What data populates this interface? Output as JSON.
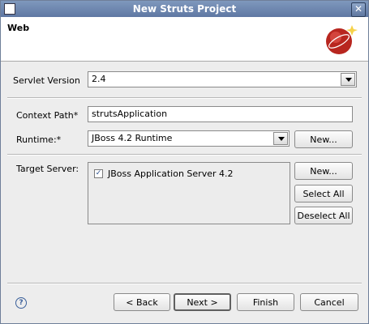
{
  "window": {
    "title": "New Struts Project",
    "close_glyph": "✕"
  },
  "header": {
    "title": "Web"
  },
  "servlet": {
    "label": "Servlet Version",
    "value": "2.4"
  },
  "context": {
    "label": "Context Path*",
    "value": "strutsApplication"
  },
  "runtime": {
    "label": "Runtime:*",
    "value": "JBoss 4.2 Runtime",
    "new_label": "New..."
  },
  "target": {
    "label": "Target Server:",
    "items": [
      {
        "label": "JBoss Application Server 4.2",
        "checked": true
      }
    ],
    "new_label": "New...",
    "select_all_label": "Select All",
    "deselect_all_label": "Deselect All"
  },
  "footer": {
    "help_glyph": "?",
    "back_label": "< Back",
    "next_label": "Next >",
    "finish_label": "Finish",
    "cancel_label": "Cancel"
  },
  "icons": {
    "help": "help-icon",
    "header_art": "jboss-logo-icon",
    "dropdown": "chevron-down-icon",
    "checkbox": "checkmark-icon"
  }
}
